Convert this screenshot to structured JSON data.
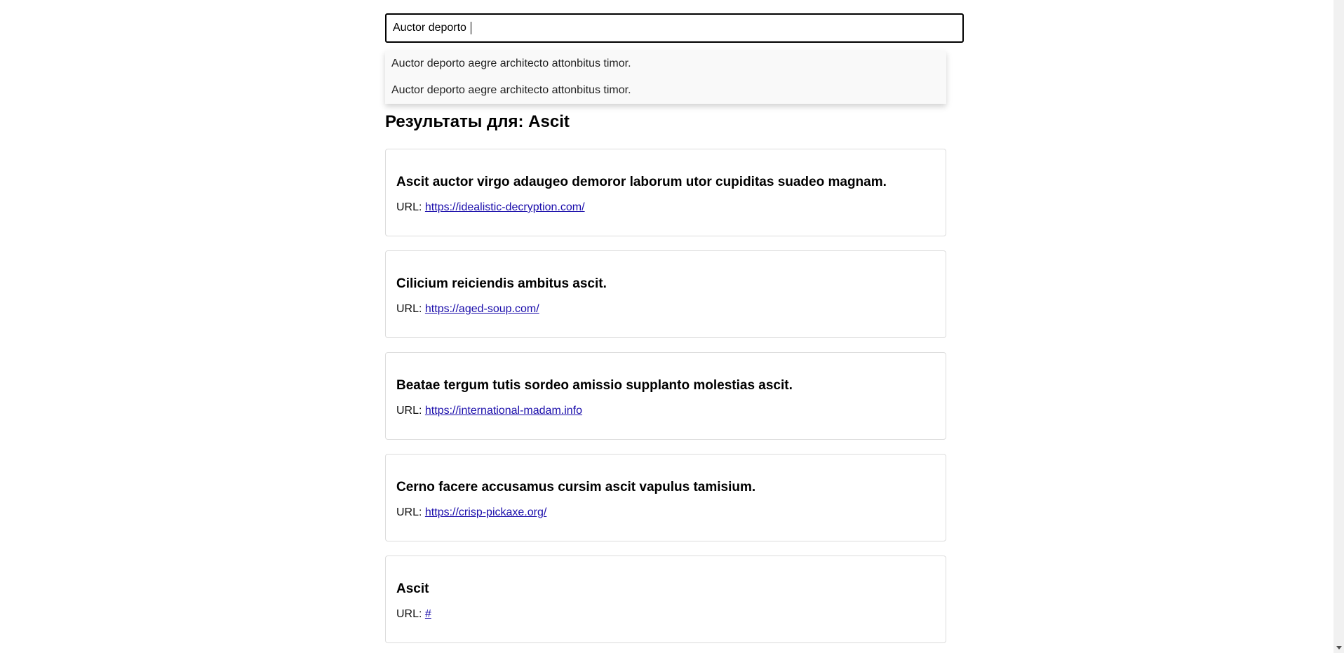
{
  "search": {
    "value": "Auctor deporto "
  },
  "suggestions": [
    "Auctor deporto aegre architecto attonbitus timor.",
    "Auctor deporto aegre architecto attonbitus timor."
  ],
  "results_heading": "Результаты для: Ascit",
  "results": [
    {
      "title": "Ascit auctor virgo adaugeo demoror laborum utor cupiditas suadeo magnam.",
      "url_label": "URL:",
      "url": "https://idealistic-decryption.com/"
    },
    {
      "title": "Cilicium reiciendis ambitus ascit.",
      "url_label": "URL:",
      "url": "https://aged-soup.com/"
    },
    {
      "title": "Beatae tergum tutis sordeo amissio supplanto molestias ascit.",
      "url_label": "URL:",
      "url": "https://international-madam.info"
    },
    {
      "title": "Cerno facere accusamus cursim ascit vapulus tamisium.",
      "url_label": "URL:",
      "url": "https://crisp-pickaxe.org/"
    },
    {
      "title": "Ascit",
      "url_label": "URL:",
      "url": "#"
    }
  ],
  "colors": {
    "link": "#1a0dab",
    "suggestion_bg": "#f9f9f9",
    "card_border": "#dcdcdc"
  },
  "icons": {
    "scroll_down": "triangle-down"
  }
}
